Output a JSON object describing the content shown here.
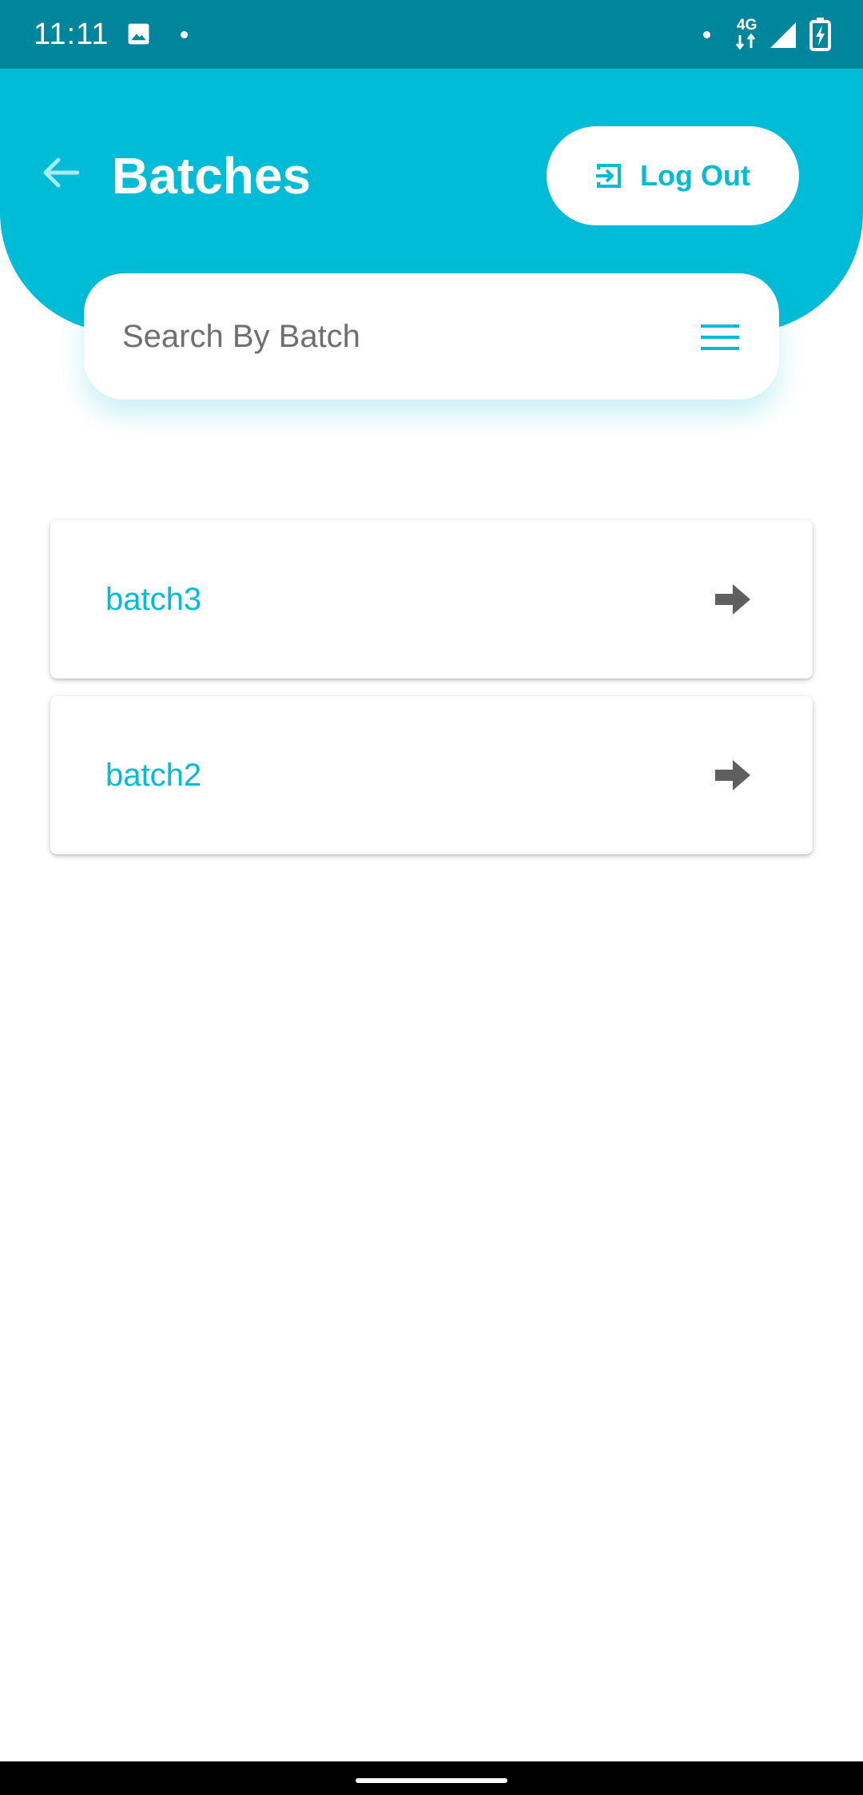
{
  "status_bar": {
    "time": "11:11",
    "network": "4G",
    "icons": [
      "photo-icon",
      "notification-dot",
      "signal-icon",
      "battery-charging-icon"
    ]
  },
  "header": {
    "title": "Batches",
    "logout_label": "Log Out"
  },
  "search": {
    "placeholder": "Search By Batch",
    "value": ""
  },
  "batches": [
    {
      "name": "batch3"
    },
    {
      "name": "batch2"
    }
  ],
  "colors": {
    "status_bar": "#00869c",
    "primary": "#00bcd6",
    "arrow": "#5f5f5f",
    "background": "#ffffff"
  }
}
